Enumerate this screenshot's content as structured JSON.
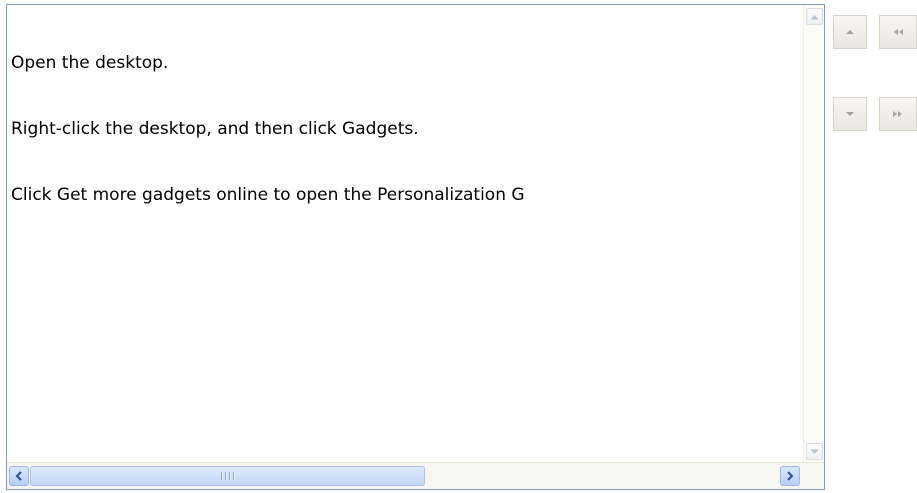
{
  "content": {
    "lines": [
      "Open the desktop.",
      "Right-click the desktop, and then click Gadgets.",
      "Click Get more gadgets online to open the Personalization G"
    ]
  },
  "icons": {
    "scroll_up": "triangle-up-icon",
    "scroll_down": "triangle-down-icon",
    "scroll_left": "chevron-left-icon",
    "scroll_right": "chevron-right-icon",
    "nav_up": "triangle-up-icon",
    "nav_down": "triangle-down-icon",
    "nav_first": "double-left-icon",
    "nav_last": "double-right-icon"
  },
  "colors": {
    "textbox_border": "#7f9db9",
    "scroll_blue": "#b7cff8",
    "nav_button": "#e9e7df",
    "nav_icon": "#a8a398"
  }
}
